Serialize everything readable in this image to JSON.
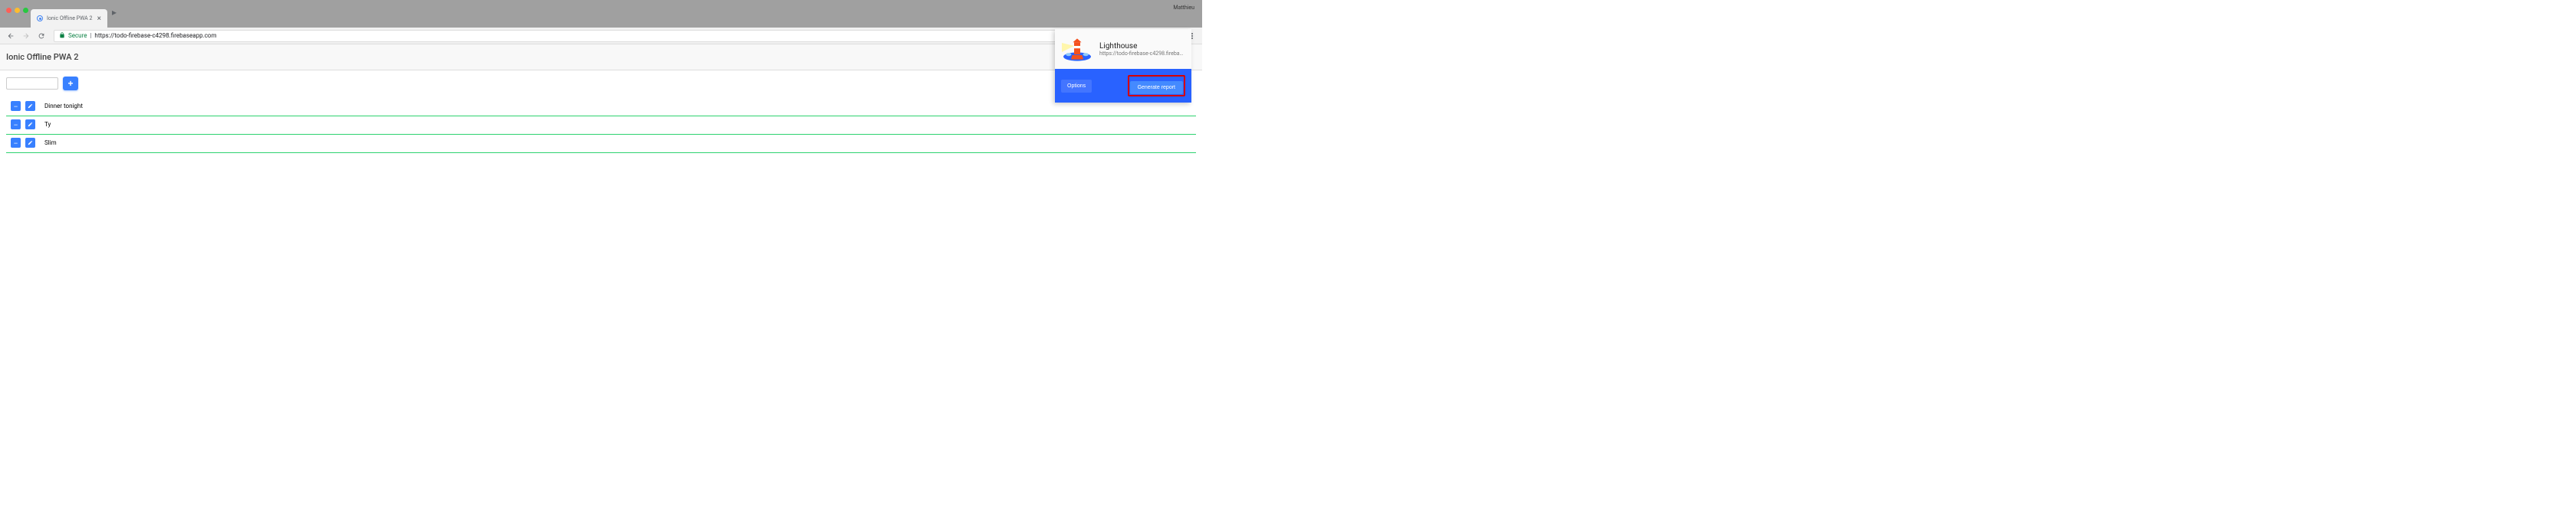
{
  "browser": {
    "profile_name": "Matthieu",
    "tab": {
      "title": "Ionic Offline PWA 2"
    },
    "address": {
      "secure_label": "Secure",
      "url": "https://todo-firebase-c4298.firebaseapp.com"
    }
  },
  "app": {
    "title": "Ionic Offline PWA 2",
    "add_button": "+",
    "new_item_value": "",
    "items": [
      {
        "text": "Dinner tonight"
      },
      {
        "text": "Ty"
      },
      {
        "text": "Slim"
      }
    ]
  },
  "lighthouse": {
    "title": "Lighthouse",
    "url": "https://todo-firebase-c4298.fireba…",
    "options_label": "Options",
    "generate_label": "Generate report"
  }
}
